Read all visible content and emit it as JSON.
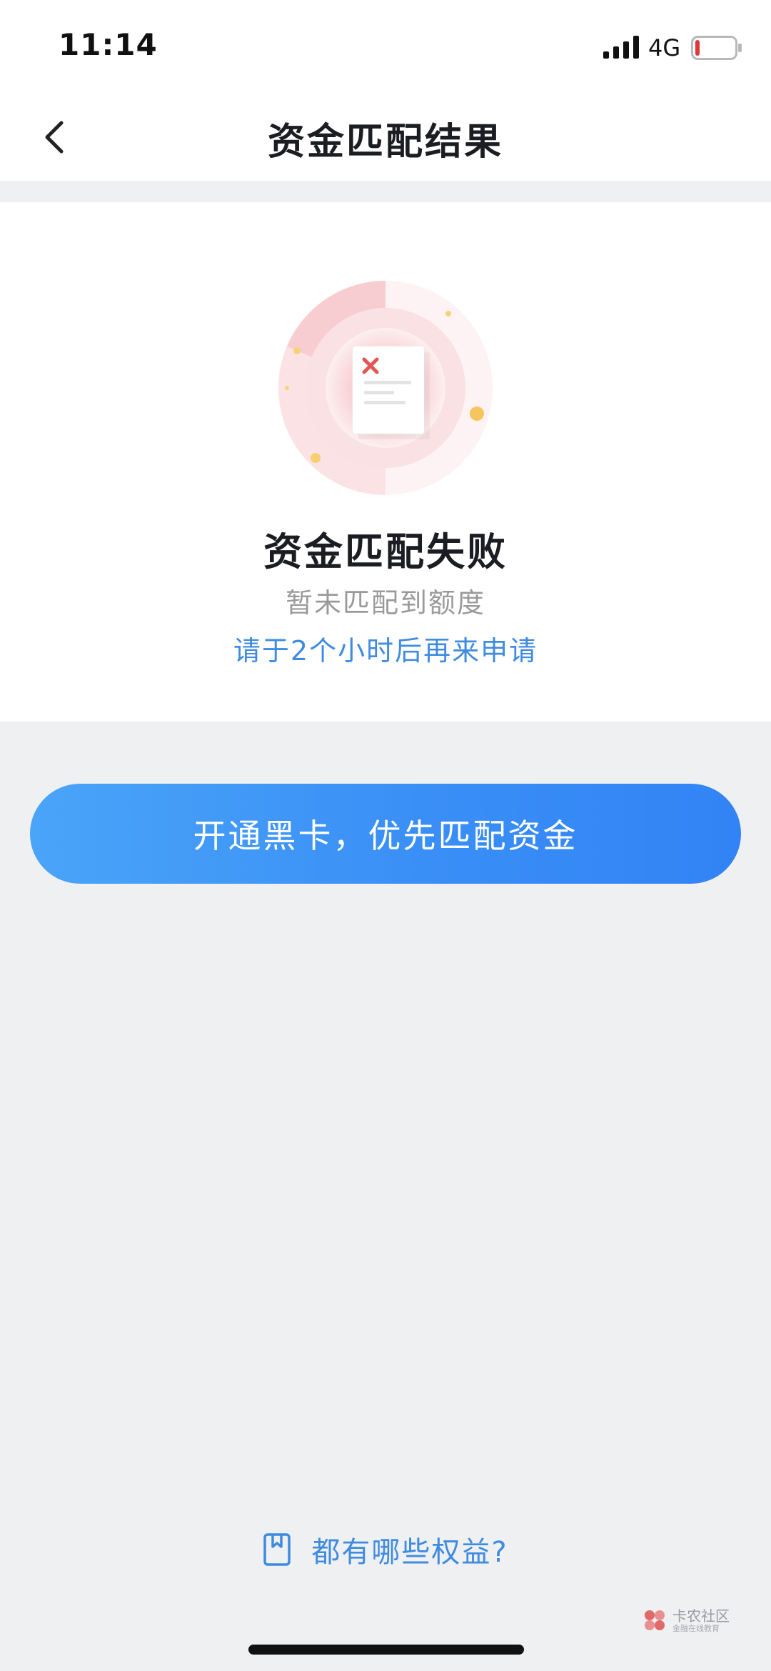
{
  "status_bar": {
    "time": "11:14",
    "network": "4G",
    "signal_icon": "signal-bars-icon",
    "battery_icon": "battery-low-icon"
  },
  "nav": {
    "title": "资金匹配结果",
    "back_icon": "chevron-left-icon"
  },
  "result": {
    "illustration_icon": "document-rejected-icon",
    "title": "资金匹配失败",
    "subtitle": "暂未匹配到额度",
    "hint": "请于2个小时后再来申请"
  },
  "cta": {
    "label": "开通黑卡，优先匹配资金"
  },
  "benefits": {
    "label": "都有哪些权益?",
    "icon": "bookmark-book-icon"
  },
  "watermark": {
    "name": "卡农社区",
    "sub": "金融在线教育"
  },
  "colors": {
    "accent_blue": "#3f8be0",
    "button_gradient_start": "#4aa4f8",
    "button_gradient_end": "#3283f5",
    "error_red": "#e25555",
    "page_background": "#eff0f2"
  }
}
